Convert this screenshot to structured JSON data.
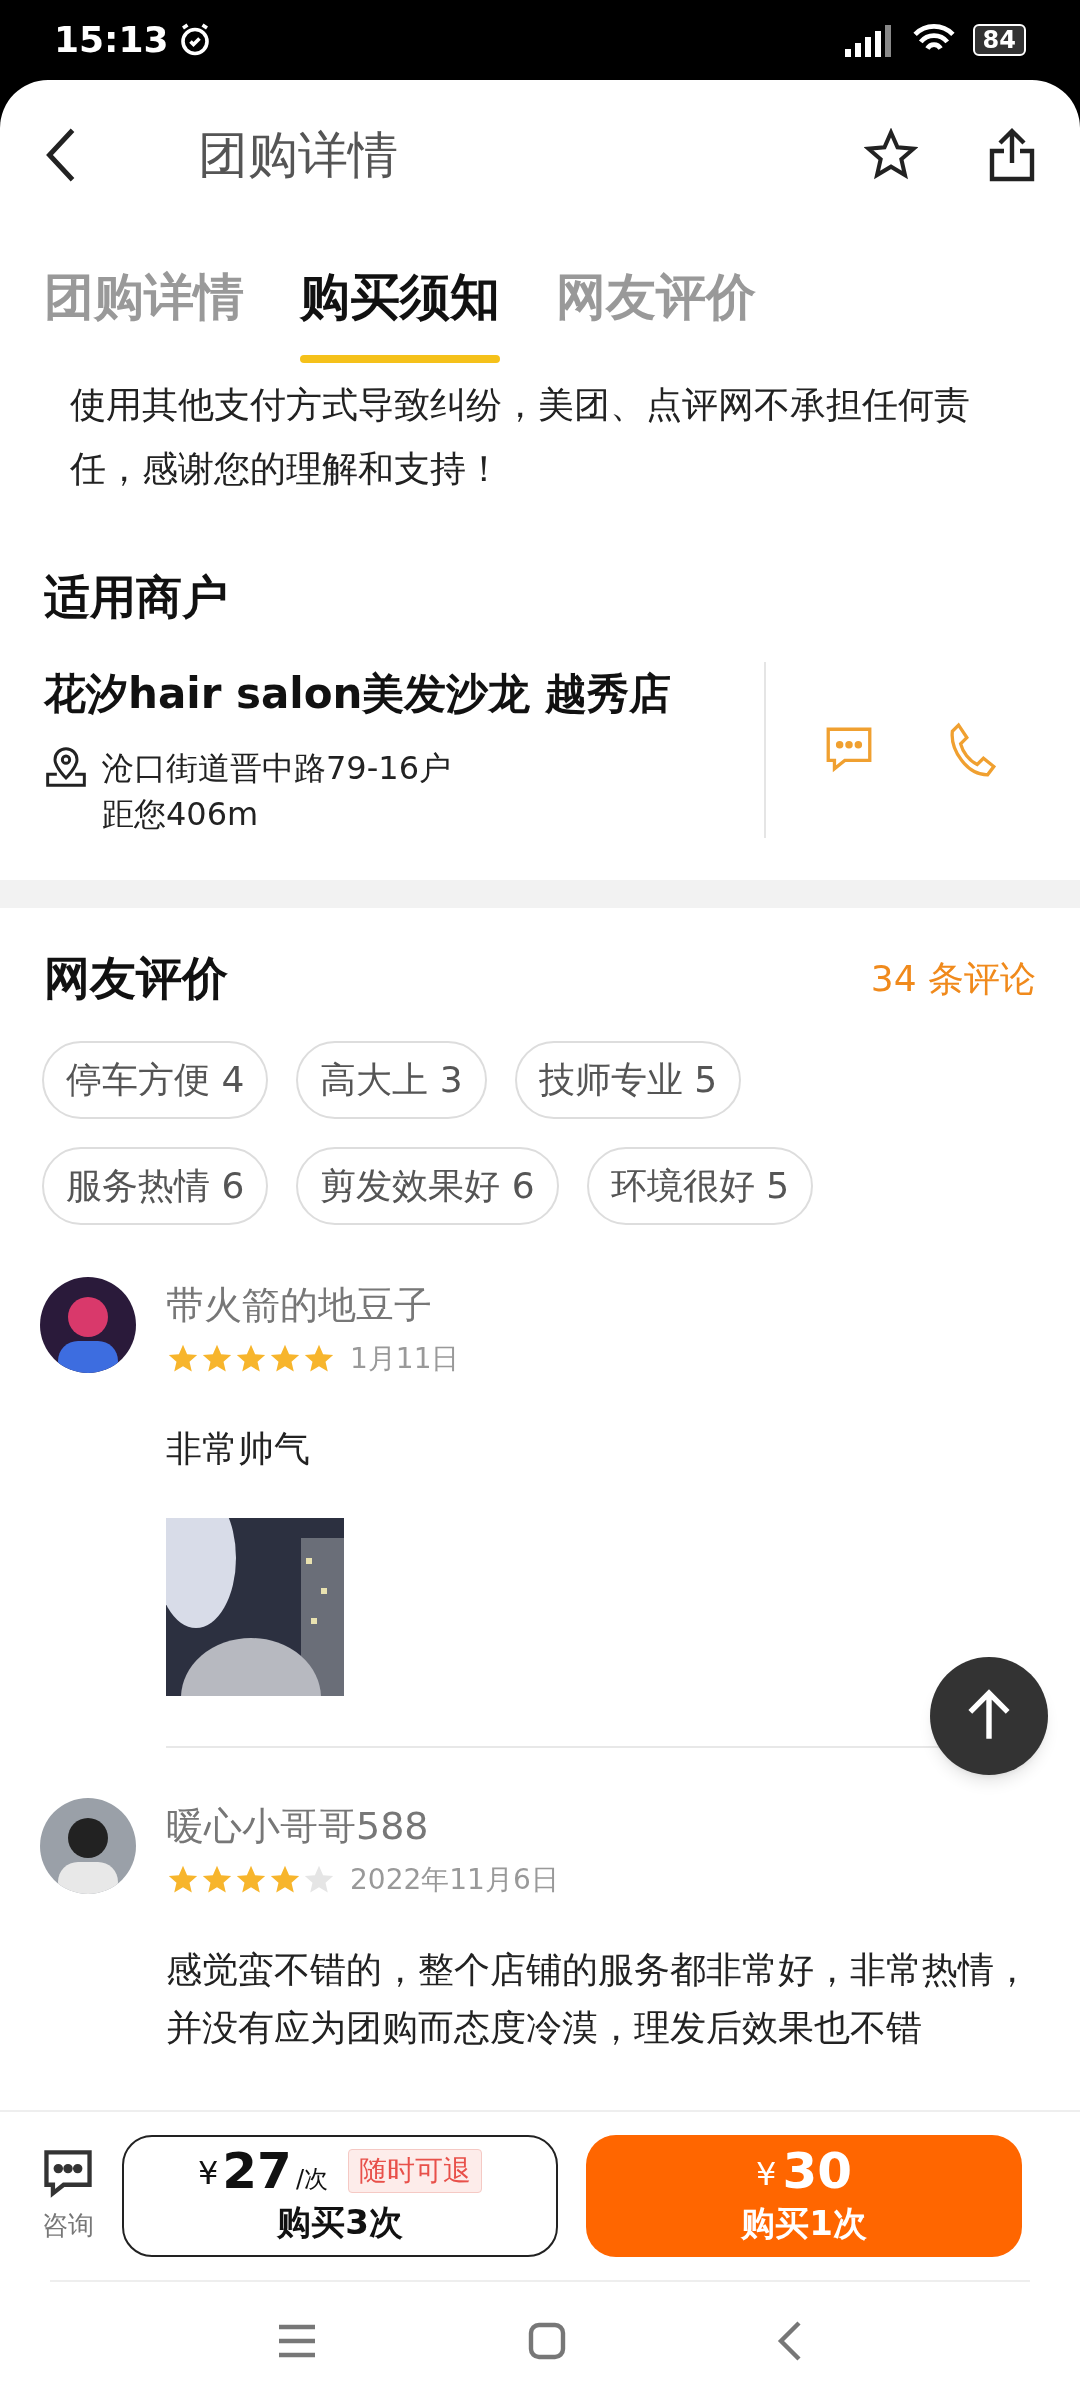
{
  "status_bar": {
    "time": "15:13",
    "battery": "84"
  },
  "header": {
    "title": "团购详情"
  },
  "tabs": [
    {
      "label": "团购详情",
      "selected": false
    },
    {
      "label": "购买须知",
      "selected": true
    },
    {
      "label": "网友评价",
      "selected": false
    }
  ],
  "notice": "使用其他支付方式导致纠纷，美团、点评网不承担任何责任，感谢您的理解和支持！",
  "merchant": {
    "heading": "适用商户",
    "name": "花汐hair salon美发沙龙 越秀店",
    "address": "沧口街道晋中路79-16户",
    "distance": "距您406m"
  },
  "reviews": {
    "heading": "网友评价",
    "count": "34 条评论",
    "tags": [
      "停车方便 4",
      "高大上 3",
      "技师专业 5",
      "服务热情 6",
      "剪发效果好 6",
      "环境很好 5"
    ],
    "items": [
      {
        "user": "带火箭的地豆子",
        "stars": 5,
        "date": "1月11日",
        "text": "非常帅气"
      },
      {
        "user": "暖心小哥哥588",
        "stars": 4,
        "date": "2022年11月6日",
        "text": "感觉蛮不错的，整个店铺的服务都非常好，非常热情，并没有应为团购而态度冷漠，理发后效果也不错"
      }
    ]
  },
  "bottom_bar": {
    "consult": "咨询",
    "multi": {
      "currency": "¥",
      "price": "27",
      "unit": "/次",
      "badge": "随时可退",
      "label": "购买3次"
    },
    "single": {
      "currency": "¥",
      "price": "30",
      "label": "购买1次"
    }
  }
}
